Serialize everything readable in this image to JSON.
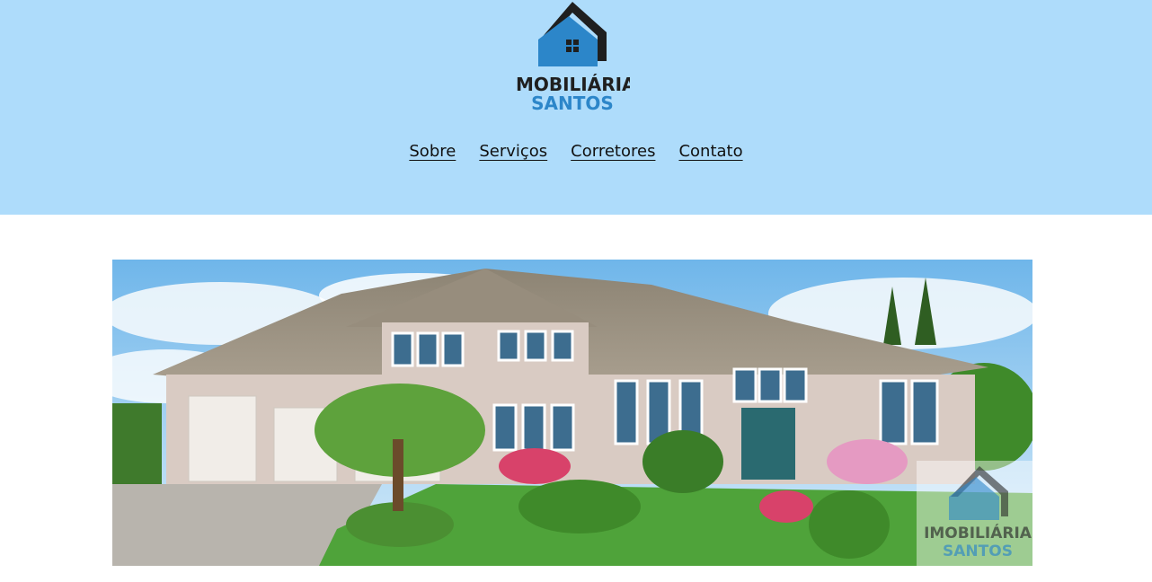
{
  "brand": {
    "line1": "IMOBILIÁRIA",
    "line2": "SANTOS",
    "color_dark": "#1f1f1f",
    "color_blue": "#2c86c9"
  },
  "colors": {
    "header_bg": "#aedcfb",
    "page_bg": "#ffffff"
  },
  "nav": {
    "items": [
      {
        "label": "Sobre"
      },
      {
        "label": "Serviços"
      },
      {
        "label": "Corretores"
      },
      {
        "label": "Contato"
      }
    ]
  },
  "hero": {
    "watermark_line1": "IMOBILIÁRIA",
    "watermark_line2": "SANTOS"
  }
}
